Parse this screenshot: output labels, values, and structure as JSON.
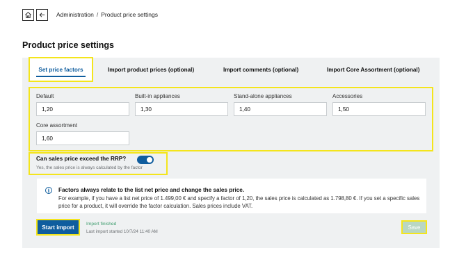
{
  "nav": {
    "breadcrumb_parent": "Administration",
    "breadcrumb_separator": "/",
    "breadcrumb_current": "Product price settings"
  },
  "page": {
    "title": "Product price settings"
  },
  "tabs": [
    {
      "label": "Set price factors",
      "active": true
    },
    {
      "label": "Import product prices (optional)",
      "active": false
    },
    {
      "label": "Import comments (optional)",
      "active": false
    },
    {
      "label": "Import Core Assortment (optional)",
      "active": false
    }
  ],
  "factors": [
    {
      "label": "Default",
      "value": "1,20"
    },
    {
      "label": "Built-in appliances",
      "value": "1,30"
    },
    {
      "label": "Stand-alone appliances",
      "value": "1,40"
    },
    {
      "label": "Accessories",
      "value": "1,50"
    },
    {
      "label": "Core assortment",
      "value": "1,60"
    }
  ],
  "rrp": {
    "title": "Can sales price exceed the RRP?",
    "enabled": true,
    "subtitle": "Yes, the sales price is always calculated by the factor"
  },
  "info": {
    "title": "Factors always relate to the list net price and change the sales price.",
    "text": "For example, if you have a list net price of 1.499,00 € and specify a factor of 1,20, the sales price is calculated as 1.798,80 €. If you set a specific sales price for a product, it will override the factor calculation. Sales prices include VAT."
  },
  "import": {
    "button_label": "Start import",
    "status": "Import finished",
    "last_started": "Last import started 10/7/24 11:40 AM"
  },
  "save": {
    "label": "Save",
    "disabled": true
  },
  "colors": {
    "accent": "#0f5d9e",
    "highlight": "#f4e51c",
    "panel_bg": "#eff1f2",
    "success_text": "#3a9b6b",
    "save_disabled": "#b9d7c3"
  }
}
